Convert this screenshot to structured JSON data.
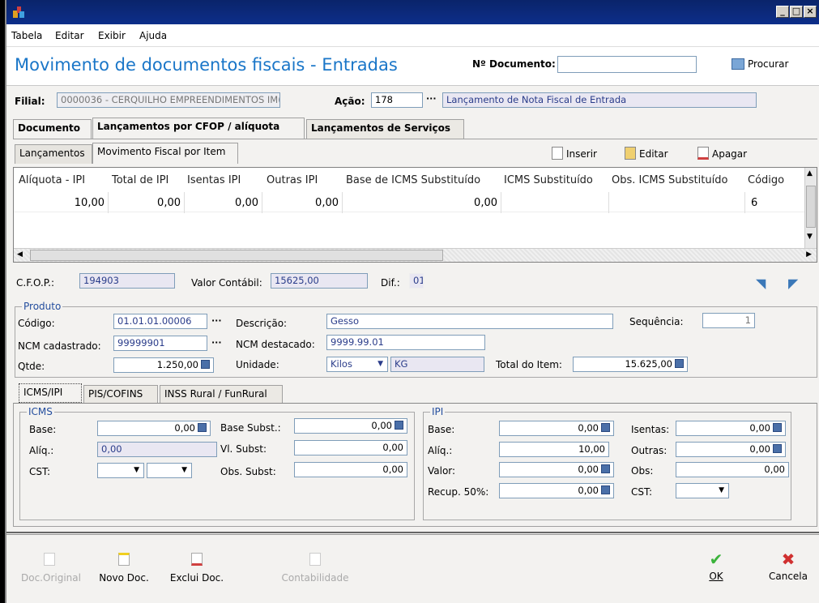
{
  "menu": [
    "Tabela",
    "Editar",
    "Exibir",
    "Ajuda"
  ],
  "header": {
    "title": "Movimento de documentos fiscais - Entradas",
    "doc_label": "Nº Documento:",
    "doc_value": "",
    "search": "Procurar"
  },
  "filial": {
    "label": "Filial:",
    "value": "0000036 - CERQUILHO EMPREENDIMENTOS IM( -",
    "acao_label": "Ação:",
    "acao_value": "178",
    "acao_desc": "Lançamento de Nota Fiscal de Entrada"
  },
  "tabs": [
    "Documento",
    "Lançamentos por CFOP / alíquota",
    "Lançamentos de Serviços"
  ],
  "subtabs": [
    "Lançamentos",
    "Movimento Fiscal por Item"
  ],
  "toolbar": {
    "insert": "Inserir",
    "edit": "Editar",
    "delete": "Apagar"
  },
  "grid": {
    "headers": [
      "Alíquota - IPI",
      "Total de IPI",
      "Isentas IPI",
      "Outras IPI",
      "Base de ICMS Substituído",
      "ICMS Substituído",
      "Obs. ICMS Substituído",
      "Código"
    ],
    "row": [
      "10,00",
      "0,00",
      "0,00",
      "0,00",
      "0,00",
      "",
      "",
      "6"
    ]
  },
  "cfop": {
    "label": "C.F.O.P.:",
    "value": "194903",
    "vc_label": "Valor Contábil:",
    "vc_value": "15625,00",
    "dif_label": "Dif.:",
    "dif_value": "01"
  },
  "produto": {
    "title": "Produto",
    "codigo_label": "Código:",
    "codigo": "01.01.01.00006",
    "desc_label": "Descrição:",
    "desc": "Gesso",
    "seq_label": "Sequência:",
    "seq": "1",
    "ncm_label": "NCM cadastrado:",
    "ncm": "99999901",
    "ncmd_label": "NCM destacado:",
    "ncmd": "9999.99.01",
    "qtde_label": "Qtde:",
    "qtde": "1.250,00",
    "unid_label": "Unidade:",
    "unid": "Kilos",
    "unid_code": "KG",
    "total_label": "Total do Item:",
    "total": "15.625,00"
  },
  "taxtabs": [
    "ICMS/IPI",
    "PIS/COFINS",
    "INSS Rural / FunRural"
  ],
  "icms": {
    "title": "ICMS",
    "base_label": "Base:",
    "base": "0,00",
    "aliq_label": "Alíq.:",
    "aliq": "0,00",
    "cst_label": "CST:",
    "bs_label": "Base Subst.:",
    "bs": "0,00",
    "vs_label": "Vl. Subst:",
    "vs": "0,00",
    "os_label": "Obs. Subst:",
    "os": "0,00"
  },
  "ipi": {
    "title": "IPI",
    "base_label": "Base:",
    "base": "0,00",
    "aliq_label": "Alíq.:",
    "aliq": "10,00",
    "valor_label": "Valor:",
    "valor": "0,00",
    "recup_label": "Recup. 50%:",
    "recup": "0,00",
    "isentas_label": "Isentas:",
    "isentas": "0,00",
    "outras_label": "Outras:",
    "outras": "0,00",
    "obs_label": "Obs:",
    "obs": "0,00",
    "cst_label": "CST:"
  },
  "bottom": {
    "original": "Doc.Original",
    "novo": "Novo Doc.",
    "exclui": "Exclui Doc.",
    "contab": "Contabilidade",
    "ok": "OK",
    "cancela": "Cancela"
  }
}
